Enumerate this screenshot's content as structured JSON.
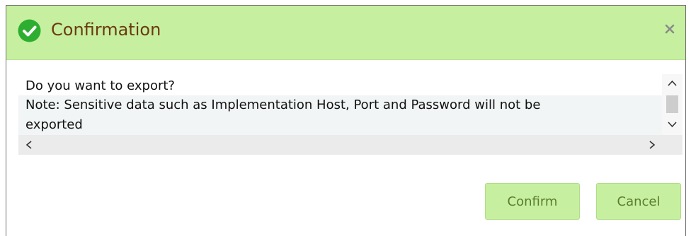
{
  "dialog": {
    "title": "Confirmation",
    "icons": {
      "status": "check-circle-icon",
      "close": "close-icon"
    },
    "colors": {
      "header_bg": "#c6f0a0",
      "title_text": "#6b3a12",
      "check_circle": "#2eae30",
      "button_bg": "#c6f0a0",
      "button_text": "#5d7a30"
    }
  },
  "message": {
    "line1": "Do you want to export?",
    "line2": "Note: Sensitive data such as Implementation Host, Port and Password will not be",
    "line3": "exported"
  },
  "buttons": {
    "confirm_label": "Confirm",
    "cancel_label": "Cancel"
  }
}
